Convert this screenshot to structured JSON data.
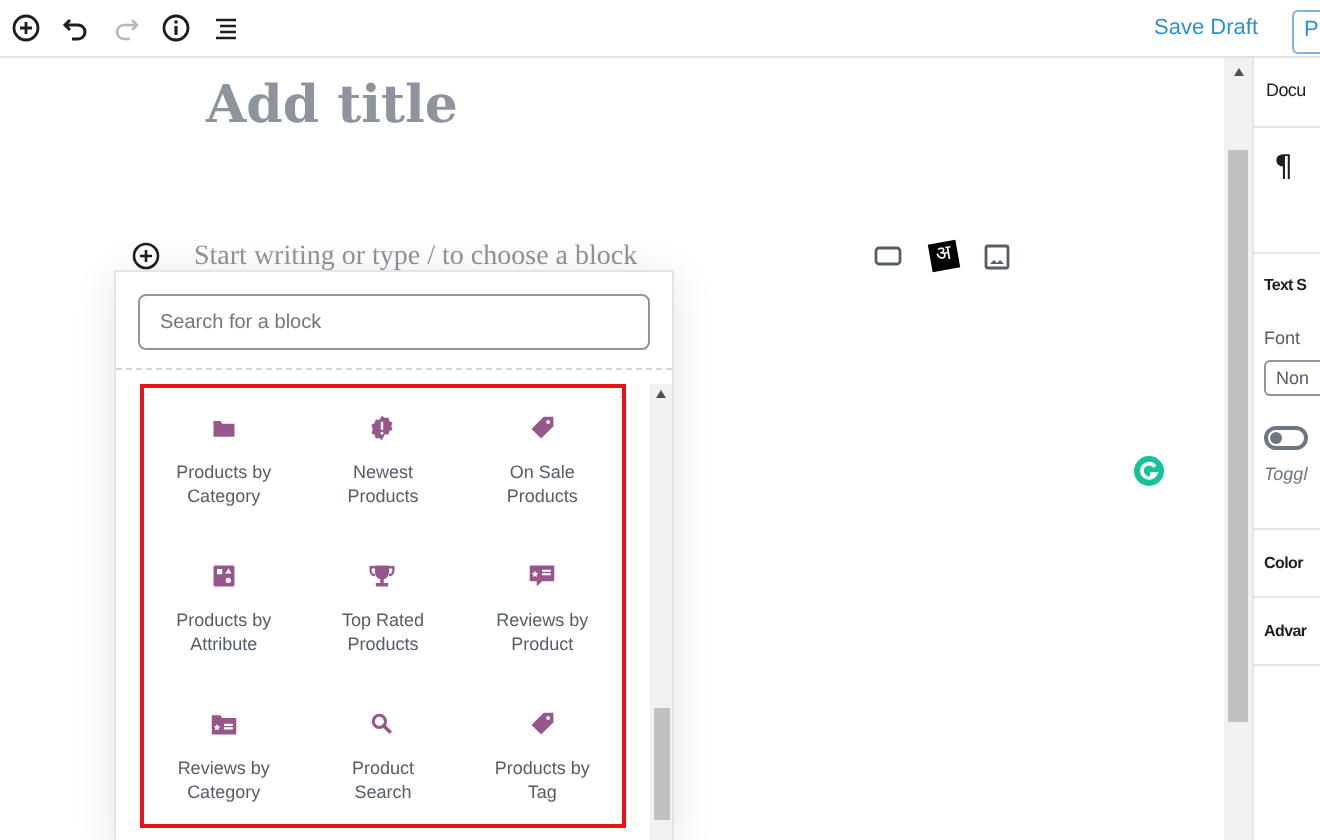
{
  "top_bar": {
    "save_label": "Save Draft",
    "publish_label": "P"
  },
  "editor": {
    "title_placeholder": "Add title",
    "body_placeholder": "Start writing or type / to choose a block",
    "glyph_tile": "अ"
  },
  "inserter": {
    "search_placeholder": "Search for a block",
    "blocks": [
      {
        "label": "Products by Category"
      },
      {
        "label": "Newest Products"
      },
      {
        "label": "On Sale Products"
      },
      {
        "label": "Products by Attribute"
      },
      {
        "label": "Top Rated Products"
      },
      {
        "label": "Reviews by Product"
      },
      {
        "label": "Reviews by Category"
      },
      {
        "label": "Product Search"
      },
      {
        "label": "Products by Tag"
      }
    ]
  },
  "sidebar": {
    "tab": "Docu",
    "block_symbol": "¶",
    "panel_title": "Text S",
    "font_label": "Font",
    "font_value": "Non",
    "toggle": {
      "on": false,
      "help": "Toggl"
    },
    "sections": [
      "Color",
      "Advar"
    ]
  }
}
